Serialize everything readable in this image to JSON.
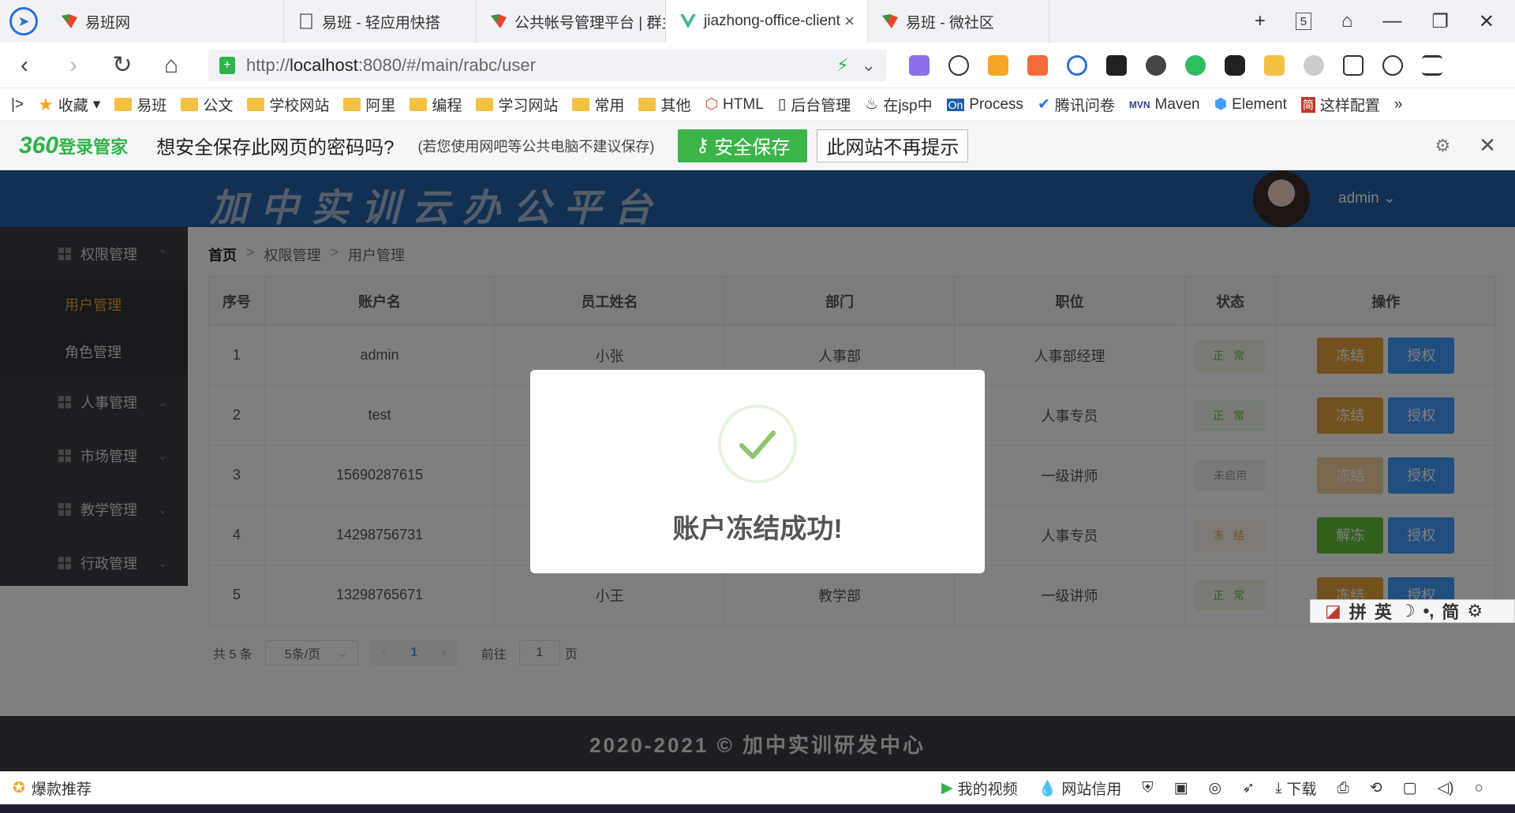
{
  "browser": {
    "tabs": [
      {
        "title": "易班网",
        "active": false
      },
      {
        "title": "易班 - 轻应用快搭",
        "active": false
      },
      {
        "title": "公共帐号管理平台 | 群主",
        "active": false
      },
      {
        "title": "jiazhong-office-client",
        "active": true
      },
      {
        "title": "易班 - 微社区",
        "active": false
      }
    ],
    "tab_count": "5",
    "url_prefix": "http://",
    "url_host": "localhost",
    "url_rest": ":8080/#/main/rabc/user",
    "bookmarks": [
      "收藏",
      "易班",
      "公文",
      "学校网站",
      "阿里",
      "编程",
      "学习网站",
      "常用",
      "其他",
      "HTML",
      "后台管理",
      "在jsp中",
      "Process",
      "腾讯问卷",
      "Maven",
      "Element",
      "这样配置",
      "»"
    ]
  },
  "password_bar": {
    "brand_prefix": "360",
    "brand_suffix": "登录管家",
    "message": "想安全保存此网页的密码吗?",
    "hint": "(若您使用网吧等公共电脑不建议保存)",
    "save_label": "安全保存",
    "never_label": "此网站不再提示"
  },
  "app": {
    "title": "加中实训云办公平台",
    "user": "admin",
    "footer": "2020-2021 © 加中实训研发中心"
  },
  "sidebar": {
    "groups": [
      {
        "label": "权限管理",
        "expanded": true,
        "children": [
          "用户管理",
          "角色管理"
        ]
      },
      {
        "label": "人事管理"
      },
      {
        "label": "市场管理"
      },
      {
        "label": "教学管理"
      },
      {
        "label": "行政管理"
      }
    ],
    "active_item": "用户管理"
  },
  "breadcrumb": [
    "首页",
    "权限管理",
    "用户管理"
  ],
  "table": {
    "headers": [
      "序号",
      "账户名",
      "员工姓名",
      "部门",
      "职位",
      "状态",
      "操作"
    ],
    "rows": [
      {
        "no": "1",
        "account": "admin",
        "name": "小张",
        "dept": "人事部",
        "position": "人事部经理",
        "status": "正 常",
        "status_type": "normal",
        "action1": "冻结",
        "action2": "授权"
      },
      {
        "no": "2",
        "account": "test",
        "name": "",
        "dept": "",
        "position": "人事专员",
        "status": "正 常",
        "status_type": "normal",
        "action1": "冻结",
        "action2": "授权"
      },
      {
        "no": "3",
        "account": "15690287615",
        "name": "",
        "dept": "",
        "position": "一级讲师",
        "status": "未启用",
        "status_type": "disabled",
        "action1": "冻结",
        "action2": "授权"
      },
      {
        "no": "4",
        "account": "14298756731",
        "name": "",
        "dept": "",
        "position": "人事专员",
        "status": "冻 结",
        "status_type": "frozen",
        "action1": "解冻",
        "action2": "授权"
      },
      {
        "no": "5",
        "account": "13298765671",
        "name": "小王",
        "dept": "教学部",
        "position": "一级讲师",
        "status": "正 常",
        "status_type": "normal",
        "action1": "冻结",
        "action2": "授权"
      }
    ]
  },
  "pager": {
    "total": "共 5 条",
    "page_size": "5条/页",
    "current": "1",
    "goto_label": "前往",
    "goto_value": "1",
    "page_unit": "页"
  },
  "modal": {
    "message": "账户冻结成功!"
  },
  "ime": [
    "拼",
    "英",
    "简"
  ],
  "statusbar": {
    "left": "爆款推荐",
    "items": [
      "我的视频",
      "网站信用",
      "下载"
    ]
  },
  "colors": {
    "header": "#2461a5",
    "sidebar": "#3a3e45",
    "success": "#67c23a",
    "warning": "#e6a23c",
    "primary": "#409eff"
  }
}
